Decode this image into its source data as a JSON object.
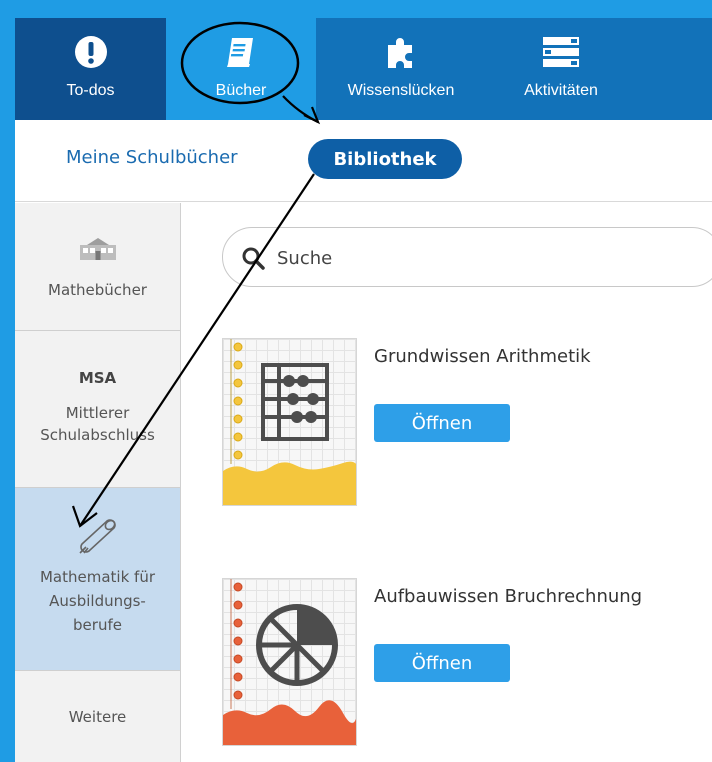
{
  "topnav": {
    "tabs": [
      {
        "label": "To-dos",
        "icon": "exclamation-icon"
      },
      {
        "label": "Bücher",
        "icon": "book-icon"
      },
      {
        "label": "Wissenslücken",
        "icon": "puzzle-icon"
      },
      {
        "label": "Aktivitäten",
        "icon": "list-icon"
      }
    ],
    "active": "Bücher"
  },
  "subnav": {
    "my_books": "Meine Schulbücher",
    "library": "Bibliothek"
  },
  "sidebar": {
    "items": [
      {
        "label": "Mathebücher",
        "icon": "school-building-icon"
      },
      {
        "abbr": "MSA",
        "label_line1": "Mittlerer",
        "label_line2": "Schulabschluss"
      },
      {
        "label_line1": "Mathematik für",
        "label_line2": "Ausbildungs-",
        "label_line3": "berufe",
        "icon": "diploma-icon"
      },
      {
        "label": "Weitere"
      }
    ],
    "active": "Mathematik für Ausbildungsberufe"
  },
  "search": {
    "placeholder": "Suche"
  },
  "books": [
    {
      "title": "Grundwissen Arithmetik",
      "button": "Öffnen",
      "cover_icon": "abacus-icon",
      "cover_color": "#f4c63d"
    },
    {
      "title": "Aufbauwissen Bruchrechnung",
      "button": "Öffnen",
      "cover_icon": "fraction-circle-icon",
      "cover_color": "#e8613a"
    }
  ],
  "colors": {
    "nav_bg": "#1272b9",
    "nav_active": "#1f9ce4",
    "button_blue": "#2e9fe8",
    "library_pill": "#0e5fa6"
  }
}
